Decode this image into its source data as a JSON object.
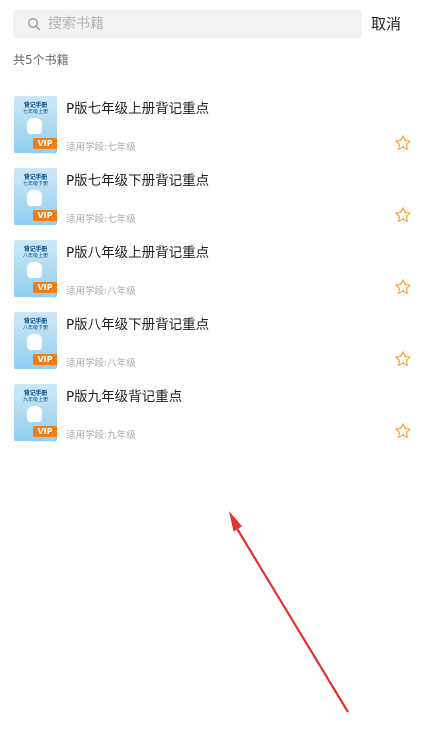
{
  "search": {
    "placeholder": "搜索书籍",
    "value": ""
  },
  "cancel_label": "取消",
  "result_count": "共5个书籍",
  "books": [
    {
      "title": "P版七年级上册背记重点",
      "grade": "适用学段:七年级",
      "cover_title": "背记手册",
      "cover_sub": "七年级上册",
      "cover_badge": "VIP"
    },
    {
      "title": "P版七年级下册背记重点",
      "grade": "适用学段:七年级",
      "cover_title": "背记手册",
      "cover_sub": "七年级下册",
      "cover_badge": "VIP"
    },
    {
      "title": "P版八年级上册背记重点",
      "grade": "适用学段:八年级",
      "cover_title": "背记手册",
      "cover_sub": "八年级上册",
      "cover_badge": "VIP"
    },
    {
      "title": "P版八年级下册背记重点",
      "grade": "适用学段:八年级",
      "cover_title": "背记手册",
      "cover_sub": "八年级下册",
      "cover_badge": "VIP"
    },
    {
      "title": "P版九年级背记重点",
      "grade": "适用学段:九年级",
      "cover_title": "背记手册",
      "cover_sub": "九年级上册",
      "cover_badge": "VIP"
    }
  ],
  "colors": {
    "star": "#f3a73b",
    "vip_badge": "#ef7d1a",
    "arrow": "#e53030"
  }
}
